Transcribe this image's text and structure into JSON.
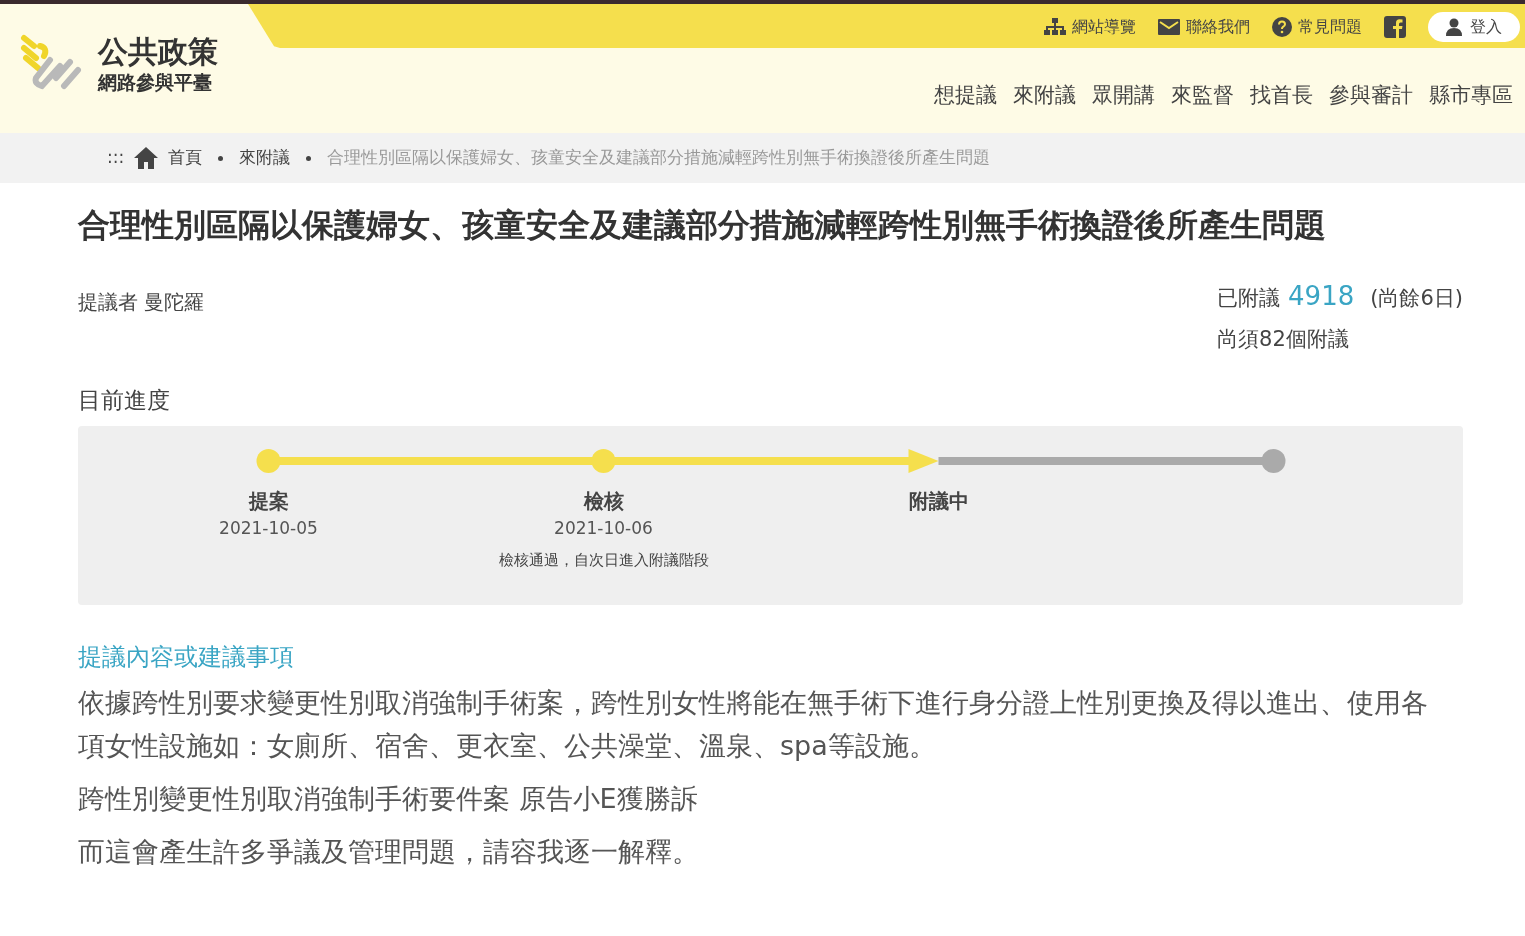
{
  "logo": {
    "title": "公共政策",
    "subtitle": "網路參與平臺"
  },
  "top_links": [
    {
      "kind": "sitemap",
      "label": "網站導覽"
    },
    {
      "kind": "mail",
      "label": "聯絡我們"
    },
    {
      "kind": "help",
      "label": "常見問題"
    },
    {
      "kind": "facebook"
    },
    {
      "kind": "login",
      "label": "登入"
    }
  ],
  "main_nav": [
    "想提議",
    "來附議",
    "眾開講",
    "來監督",
    "找首長",
    "參與審計",
    "縣市專區"
  ],
  "breadcrumb": {
    "marker": ":::",
    "items": [
      "首頁",
      "來附議",
      "合理性別區隔以保護婦女、孩童安全及建議部分措施減輕跨性別無手術換證後所產生問題"
    ]
  },
  "title": "合理性別區隔以保護婦女、孩童安全及建議部分措施減輕跨性別無手術換證後所產生問題",
  "proposer": "提議者 曼陀羅",
  "endorse": {
    "label": "已附議",
    "count": "4918",
    "remaining_days": "(尚餘6日)",
    "needed": "尚須82個附議"
  },
  "progress_heading": "目前進度",
  "steps": [
    {
      "reached": true,
      "current": false,
      "label": "提案",
      "date": "2021-10-05"
    },
    {
      "reached": true,
      "current": false,
      "label": "檢核",
      "date": "2021-10-06",
      "note": "檢核通過，自次日進入附議階段"
    },
    {
      "reached": true,
      "current": true,
      "label": "附議中"
    },
    {
      "reached": false,
      "current": false
    }
  ],
  "content_heading": "提議內容或建議事項",
  "paragraphs": [
    "依據跨性別要求變更性別取消強制手術案，跨性別女性將能在無手術下進行身分證上性別更換及得以進出、使用各項女性設施如：女廁所、宿舍、更衣室、公共澡堂、溫泉、spa等設施。",
    "跨性別變更性別取消強制手術要件案 原告小E獲勝訴",
    "而這會產生許多爭議及管理問題，請容我逐一解釋。"
  ]
}
